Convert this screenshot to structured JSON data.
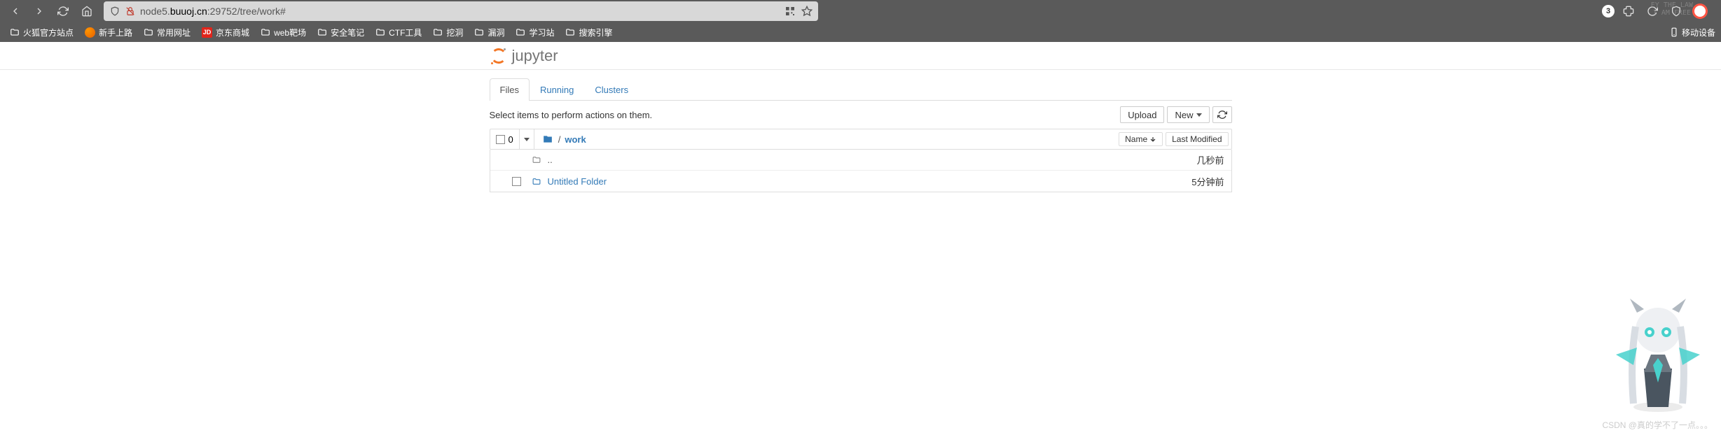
{
  "browser": {
    "url_prefix": "node5.",
    "url_domain": "buuoj.cn",
    "url_suffix": ":29752/tree/work#",
    "badge_count": "3",
    "decor_line1": "EY THE LAW",
    "decor_line2": "I AM FREE"
  },
  "bookmarks": [
    {
      "icon": "folder",
      "label": "火狐官方站点"
    },
    {
      "icon": "firefox",
      "label": "新手上路"
    },
    {
      "icon": "folder",
      "label": "常用网址"
    },
    {
      "icon": "jd",
      "label": "京东商城"
    },
    {
      "icon": "folder",
      "label": "web靶场"
    },
    {
      "icon": "folder",
      "label": "安全笔记"
    },
    {
      "icon": "folder",
      "label": "CTF工具"
    },
    {
      "icon": "folder",
      "label": "挖洞"
    },
    {
      "icon": "folder",
      "label": "漏洞"
    },
    {
      "icon": "folder",
      "label": "学习站"
    },
    {
      "icon": "folder",
      "label": "搜索引擎"
    }
  ],
  "bookmark_right": "移动设备",
  "logo_text": "jupyter",
  "tabs": {
    "files": "Files",
    "running": "Running",
    "clusters": "Clusters"
  },
  "hint": "Select items to perform actions on them.",
  "buttons": {
    "upload": "Upload",
    "new": "New"
  },
  "select_count": "0",
  "breadcrumb": {
    "sep": "/",
    "current": "work"
  },
  "sort": {
    "name": "Name",
    "modified": "Last Modified"
  },
  "files": [
    {
      "checkbox": false,
      "icon": "folder-outline",
      "name": "..",
      "link": false,
      "time": "几秒前"
    },
    {
      "checkbox": true,
      "icon": "folder-outline",
      "name": "Untitled Folder",
      "link": true,
      "time": "5分钟前"
    }
  ],
  "watermark": "CSDN @真的学不了一点。。。"
}
